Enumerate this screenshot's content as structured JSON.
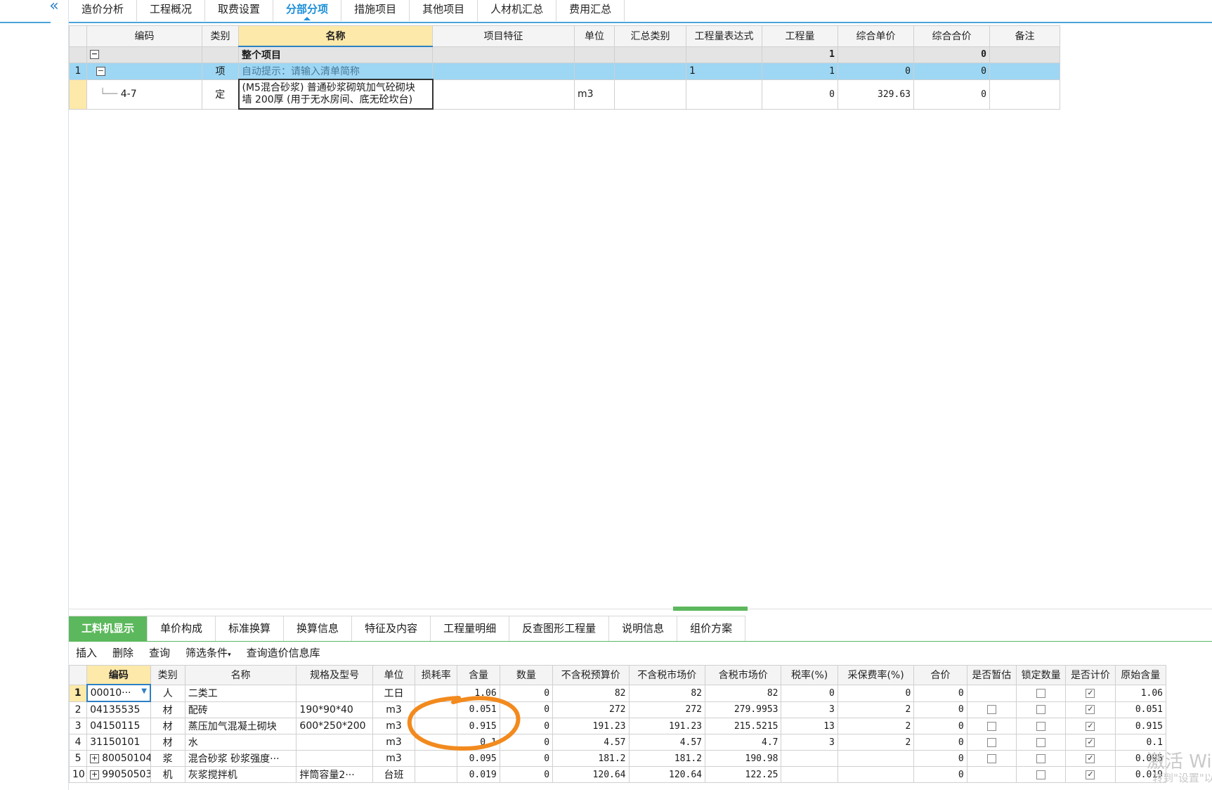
{
  "top_tabs": [
    "造价分析",
    "工程概况",
    "取费设置",
    "分部分项",
    "措施项目",
    "其他项目",
    "人材机汇总",
    "费用汇总"
  ],
  "active_top_tab": "分部分项",
  "upper_table": {
    "headers": [
      "编码",
      "类别",
      "名称",
      "项目特征",
      "单位",
      "汇总类别",
      "工程量表达式",
      "工程量",
      "综合单价",
      "综合合价",
      "备注"
    ],
    "whole_project": {
      "name": "整个项目",
      "quantity": "1",
      "total": "0"
    },
    "item_row": {
      "rownum": "1",
      "type": "项",
      "name_hint": "自动提示：请输入清单简称",
      "expr": "1",
      "quantity": "1",
      "unit_price": "0",
      "total": "0"
    },
    "quota_row": {
      "code": "4-7",
      "type": "定",
      "name_line1": "(M5混合砂浆) 普通砂浆砌筑加气砼砌块",
      "name_line2": "墙 200厚 (用于无水房间、底无砼坎台)",
      "unit": "m3",
      "quantity": "0",
      "unit_price": "329.63",
      "total": "0"
    }
  },
  "bottom_tabs": [
    "工料机显示",
    "单价构成",
    "标准换算",
    "换算信息",
    "特征及内容",
    "工程量明细",
    "反查图形工程量",
    "说明信息",
    "组价方案"
  ],
  "active_bottom_tab": "工料机显示",
  "toolbar": {
    "insert": "插入",
    "delete": "删除",
    "query": "查询",
    "filter": "筛选条件",
    "query_db": "查询造价信息库"
  },
  "lower_table": {
    "headers": [
      "编码",
      "类别",
      "名称",
      "规格及型号",
      "单位",
      "损耗率",
      "含量",
      "数量",
      "不含税预算价",
      "不含税市场价",
      "含税市场价",
      "税率(%)",
      "采保费率(%)",
      "合价",
      "是否暂估",
      "锁定数量",
      "是否计价",
      "原始含量"
    ],
    "rows": [
      {
        "rn": "1",
        "code": "00010···",
        "type": "人",
        "name": "二类工",
        "spec": "",
        "unit": "工日",
        "loss": "",
        "content": "1.06",
        "qty": "0",
        "bud": "82",
        "mkt": "82",
        "mkt_tax": "82",
        "tax": "0",
        "fee": "0",
        "total": "0",
        "est": "",
        "lock": "☐",
        "priced": "☑",
        "orig": "1.06"
      },
      {
        "rn": "2",
        "code": "04135535",
        "type": "材",
        "name": "配砖",
        "spec": "190*90*40",
        "unit": "m3",
        "loss": "",
        "content": "0.051",
        "qty": "0",
        "bud": "272",
        "mkt": "272",
        "mkt_tax": "279.9953",
        "tax": "3",
        "fee": "2",
        "total": "0",
        "est": "☐",
        "lock": "☐",
        "priced": "☑",
        "orig": "0.051"
      },
      {
        "rn": "3",
        "code": "04150115",
        "type": "材",
        "name": "蒸压加气混凝土砌块",
        "spec": "600*250*200",
        "unit": "m3",
        "loss": "",
        "content": "0.915",
        "qty": "0",
        "bud": "191.23",
        "mkt": "191.23",
        "mkt_tax": "215.5215",
        "tax": "13",
        "fee": "2",
        "total": "0",
        "est": "☐",
        "lock": "☐",
        "priced": "☑",
        "orig": "0.915"
      },
      {
        "rn": "4",
        "code": "31150101",
        "type": "材",
        "name": "水",
        "spec": "",
        "unit": "m3",
        "loss": "",
        "content": "0.1",
        "qty": "0",
        "bud": "4.57",
        "mkt": "4.57",
        "mkt_tax": "4.7",
        "tax": "3",
        "fee": "2",
        "total": "0",
        "est": "☐",
        "lock": "☐",
        "priced": "☑",
        "orig": "0.1"
      },
      {
        "rn": "5",
        "code": "80050104",
        "type": "浆",
        "name": "混合砂浆 砂浆强度···",
        "spec": "",
        "unit": "m3",
        "loss": "",
        "content": "0.095",
        "qty": "0",
        "bud": "181.2",
        "mkt": "181.2",
        "mkt_tax": "190.98",
        "tax": "",
        "fee": "",
        "total": "0",
        "est": "☐",
        "lock": "☐",
        "priced": "☑",
        "orig": "0.095"
      },
      {
        "rn": "10",
        "code": "99050503",
        "type": "机",
        "name": "灰浆搅拌机",
        "spec": "拌筒容量2···",
        "unit": "台班",
        "loss": "",
        "content": "0.019",
        "qty": "0",
        "bud": "120.64",
        "mkt": "120.64",
        "mkt_tax": "122.25",
        "tax": "",
        "fee": "",
        "total": "0",
        "est": "",
        "lock": "☐",
        "priced": "☑",
        "orig": "0.019"
      }
    ]
  },
  "watermark": {
    "line1": "激活 Wi",
    "line2": "转到\"设置\"以"
  },
  "colors": {
    "accent_blue": "#1d8fd8",
    "green_tab": "#5cb85c",
    "highlight_row": "#9dd7f4",
    "header_yellow": "#fde9a9",
    "annotation_orange": "#f28a1e"
  }
}
